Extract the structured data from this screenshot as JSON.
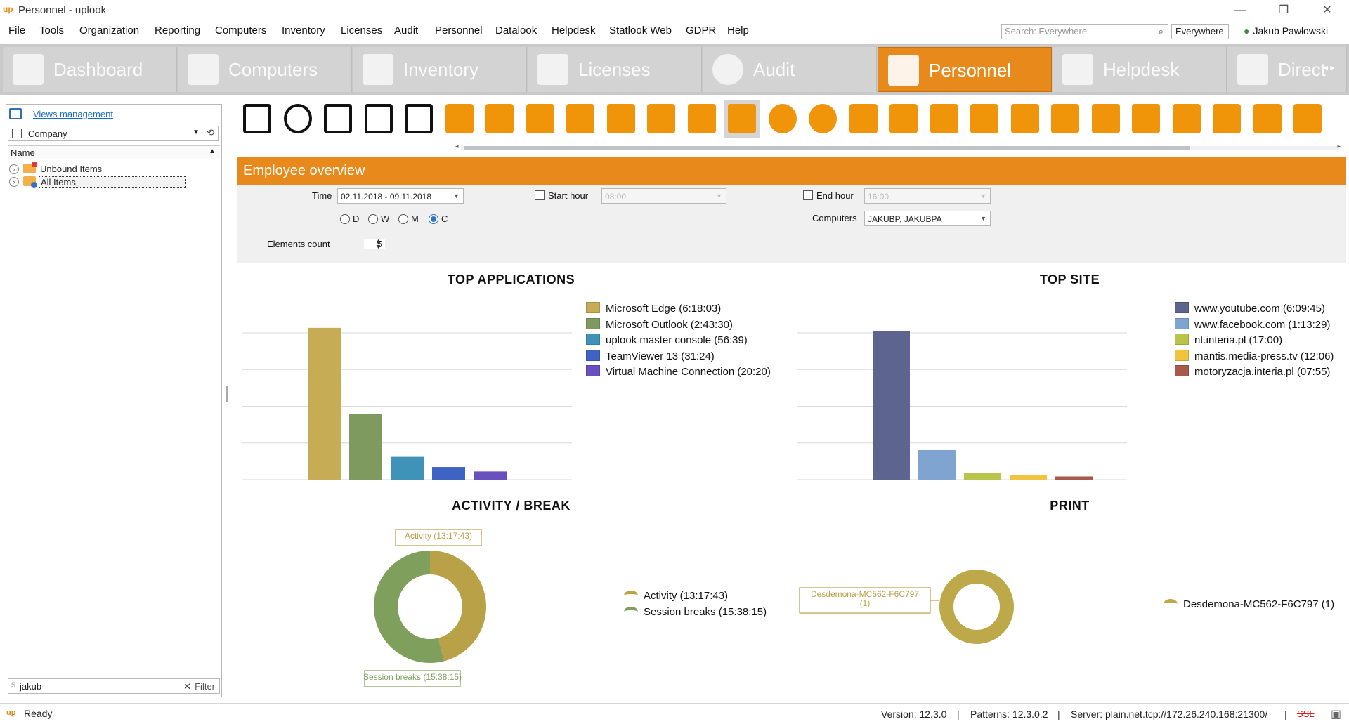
{
  "window": {
    "title": "Personnel - uplook",
    "logo_text": "up",
    "minimize_glyph": "—",
    "restore_glyph": "❐",
    "close_glyph": "✕"
  },
  "menu": [
    "File",
    "Tools",
    "Organization",
    "Reporting",
    "Computers",
    "Inventory",
    "Licenses",
    "Audit",
    "Personnel",
    "Datalook",
    "Helpdesk",
    "Statlook Web",
    "GDPR",
    "Help"
  ],
  "search": {
    "placeholder": "Search: Everywhere",
    "scope": "Everywhere",
    "icon": "search-icon"
  },
  "user": {
    "name": "Jakub Pawłowski",
    "icon": "user-icon"
  },
  "modules": [
    {
      "label": "Dashboard",
      "icon": "home-icon"
    },
    {
      "label": "Computers",
      "icon": "computers-icon"
    },
    {
      "label": "Inventory",
      "icon": "inventory-icon"
    },
    {
      "label": "Licenses",
      "icon": "key-icon"
    },
    {
      "label": "Audit",
      "icon": "audit-icon"
    },
    {
      "label": "Personnel",
      "icon": "people-icon",
      "active": true
    },
    {
      "label": "Helpdesk",
      "icon": "helpdesk-icon"
    },
    {
      "label": "Direct",
      "icon": "direct-icon"
    }
  ],
  "modules_scroll": "◂ ▸",
  "left_panel": {
    "views_link": "Views management",
    "company": "Company",
    "tree_header": "Name",
    "tree_items": [
      {
        "label": "Unbound Items",
        "icon": "folder-red-icon"
      },
      {
        "label": "All Items",
        "icon": "folder-blue-icon",
        "selected": true
      }
    ],
    "filter_value": "jakub",
    "filter_label": "Filter",
    "filter_count": "5"
  },
  "toolbar_icons": [
    "home-icon",
    "refresh-icon",
    "settings-icon",
    "save-icon",
    "print-icon",
    "group-icon",
    "users-icon",
    "user-attach-icon",
    "user-documents-icon",
    "user-time-icon",
    "info-document-icon",
    "user-settings-icon",
    "calendar-grid-icon",
    "calendar-clock-icon",
    "computer-clock-icon",
    "clock-cup-icon",
    "cursor-icon",
    "one-icon",
    "lock-icon",
    "signal-icon",
    "user-stats-icon",
    "printer-icon",
    "user-chat-icon",
    "www-eye-icon",
    "www-pie-icon",
    "www-download-icon",
    "check-add-icon"
  ],
  "overview": {
    "title": "Employee overview",
    "time_label": "Time",
    "time_value": "02.11.2018 - 09.11.2018",
    "start_hour_label": "Start hour",
    "start_hour_value": "08:00",
    "end_hour_label": "End hour",
    "end_hour_value": "16:00",
    "computers_label": "Computers",
    "computers_value": "JAKUBP, JAKUBPA",
    "period_options": [
      "D",
      "W",
      "M",
      "C"
    ],
    "period_selected": "C",
    "elements_label": "Elements count",
    "elements_value": "5"
  },
  "chart_data": [
    {
      "type": "bar",
      "title": "TOP APPLICATIONS",
      "categories": [
        "Microsoft Edge (6:18:03)",
        "Microsoft Outlook (2:43:30)",
        "uplook master console (56:39)",
        "TeamViewer 13 (31:24)",
        "Virtual Machine Connection (20:20)"
      ],
      "values": [
        22683,
        9810,
        3399,
        1884,
        1220
      ],
      "colors": [
        "#c6ac54",
        "#7f9a5e",
        "#3f93b9",
        "#3f63c2",
        "#6a4fbf"
      ],
      "ylim": [
        0,
        24000
      ],
      "grid": true,
      "legend": "right"
    },
    {
      "type": "bar",
      "title": "TOP SITE",
      "categories": [
        "www.youtube.com (6:09:45)",
        "www.facebook.com (1:13:29)",
        "nt.interia.pl (17:00)",
        "mantis.media-press.tv (12:06)",
        "motoryzacja.interia.pl (07:55)"
      ],
      "values": [
        22185,
        4409,
        1020,
        726,
        475
      ],
      "colors": [
        "#5d6490",
        "#7ea4cf",
        "#b8c44a",
        "#f1c33f",
        "#a55a4c"
      ],
      "ylim": [
        0,
        24000
      ],
      "grid": true,
      "legend": "right"
    },
    {
      "type": "pie",
      "title": "ACTIVITY / BREAK",
      "categories": [
        "Activity (13:17:43)",
        "Session breaks (15:38:15)"
      ],
      "values": [
        47863,
        56295
      ],
      "colors": [
        "#b9a148",
        "#7fa05d"
      ],
      "data_labels": [
        "Activity (13:17:43)",
        "Session breaks (15:38:15)"
      ],
      "legend": "right"
    },
    {
      "type": "pie",
      "title": "PRINT",
      "categories": [
        "Desdemona-MC562-F6C797 (1)"
      ],
      "values": [
        1
      ],
      "colors": [
        "#bda84a"
      ],
      "data_labels": [
        "Desdemona-MC562-F6C797\n(1)"
      ],
      "legend": "right"
    }
  ],
  "status": {
    "ready": "Ready",
    "version": "Version: 12.3.0",
    "patterns": "Patterns: 12.3.0.2",
    "server": "Server: plain.net.tcp://172.26.240.168:21300/",
    "ssl": "SSL",
    "separator": "|"
  }
}
